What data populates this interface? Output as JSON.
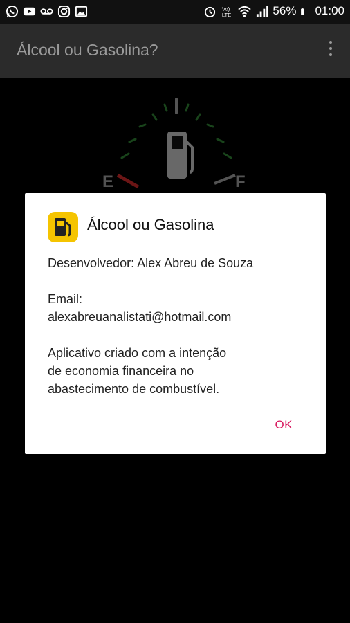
{
  "status_bar": {
    "battery_percent": "56%",
    "time": "01:00",
    "left_icons": [
      "whatsapp-icon",
      "youtube-icon",
      "voicemail-icon",
      "instagram-icon",
      "image-icon"
    ],
    "right_icons": [
      "alarm-icon",
      "volte-icon",
      "wifi-icon",
      "signal-icon",
      "battery-icon"
    ]
  },
  "app_bar": {
    "title": "Álcool ou Gasolina?"
  },
  "gauge": {
    "empty_label": "E",
    "full_label": "F"
  },
  "dialog": {
    "title": "Álcool ou Gasolina",
    "developer": "Desenvolvedor: Alex Abreu de Souza",
    "email_label": "Email:",
    "email_value": "alexabreuanalistati@hotmail.com",
    "description_lines": [
      "Aplicativo criado com a intenção",
      "de economia financeira no",
      "abastecimento de combustível."
    ],
    "ok_label": "OK"
  },
  "colors": {
    "accent": "#d81b60",
    "icon_bg": "#f5c400",
    "app_bar": "#2b2b2b"
  }
}
